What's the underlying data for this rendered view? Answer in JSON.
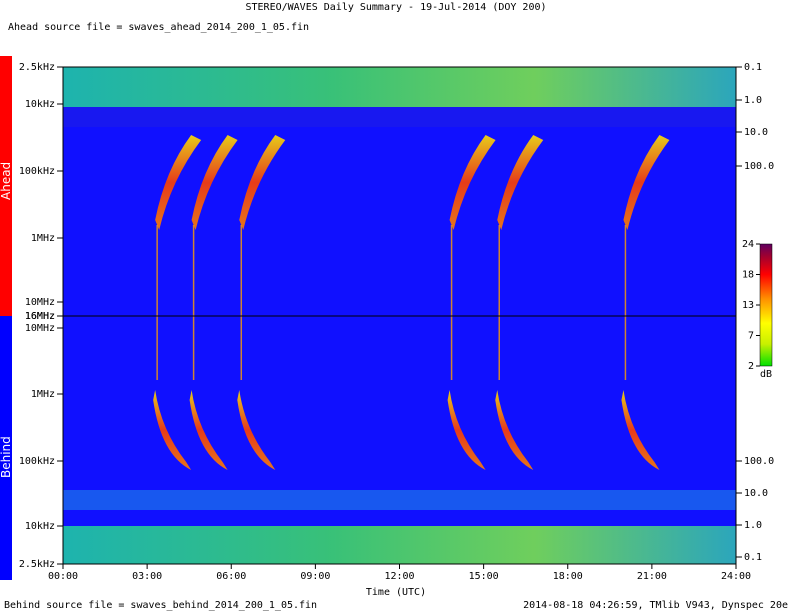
{
  "header": {
    "title": "STEREO/WAVES Daily Summary - 19-Jul-2014 (DOY 200)",
    "ahead_source": "Ahead source file = swaves_ahead_2014_200_1_05.fin",
    "behind_source": "Behind source file = swaves_behind_2014_200_1_05.fin",
    "footer_info": "2014-08-18 04:26:59, TMlib V943, Dynspec 20e"
  },
  "chart_data": {
    "type": "heatmap",
    "title": "STEREO/WAVES Daily Summary - 19-Jul-2014 (DOY 200)",
    "xlabel": "Time (UTC)",
    "x_ticks": [
      "00:00",
      "03:00",
      "06:00",
      "09:00",
      "12:00",
      "15:00",
      "18:00",
      "21:00",
      "24:00"
    ],
    "panels": [
      {
        "name": "Ahead",
        "color": "#ff0000",
        "y_ticks": [
          "2.5kHz",
          "10kHz",
          "100kHz",
          "1MHz",
          "10MHz",
          "16MHz"
        ],
        "right_ticks": [
          "0.1",
          "1.0",
          "10.0",
          "100.0"
        ]
      },
      {
        "name": "Behind",
        "color": "#0000ff",
        "y_ticks": [
          "16MHz",
          "10MHz",
          "1MHz",
          "100kHz",
          "10kHz",
          "2.5kHz"
        ],
        "right_ticks": [
          "100.0",
          "10.0",
          "1.0",
          "0.1"
        ]
      }
    ],
    "colorbar": {
      "ticks": [
        "24",
        "18",
        "13",
        "7",
        "2"
      ],
      "unit": "dB",
      "range": [
        2,
        24
      ]
    },
    "bursts_hours": [
      3.5,
      4.8,
      6.5,
      14.0,
      15.7,
      20.2
    ]
  }
}
